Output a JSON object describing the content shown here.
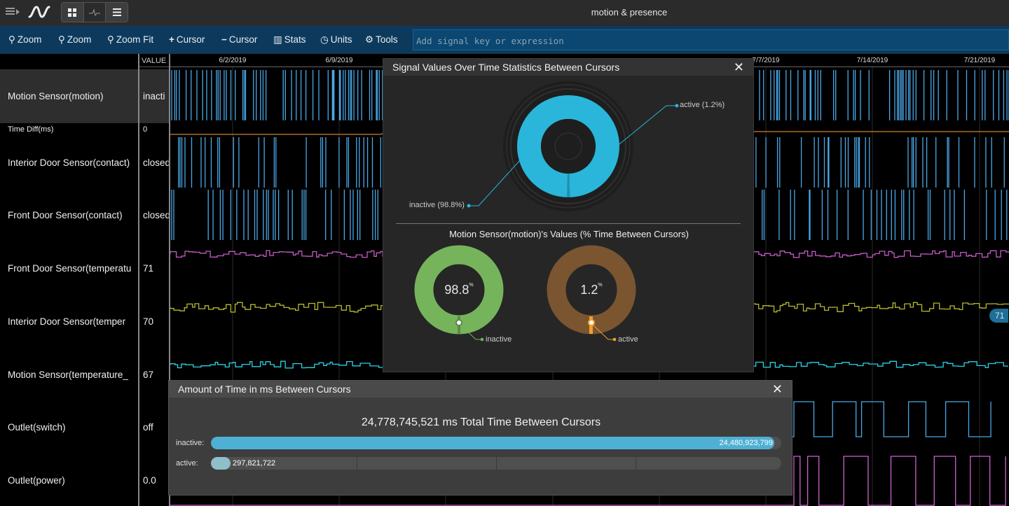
{
  "app": {
    "title": "motion & presence"
  },
  "toolbar": {
    "zoom_in": "Zoom",
    "zoom_out": "Zoom",
    "zoom_fit": "Zoom Fit",
    "add_cursor": "Cursor",
    "remove_cursor": "Cursor",
    "stats": "Stats",
    "units": "Units",
    "tools": "Tools",
    "search_placeholder": "Add signal key or expression"
  },
  "signals": {
    "value_header": "VALUE",
    "rows": [
      {
        "name": "Motion Sensor(motion)",
        "value": "inacti"
      },
      {
        "name": "Time Diff(ms)",
        "value": "0"
      },
      {
        "name": "Interior Door Sensor(contact)",
        "value": "closed"
      },
      {
        "name": "Front Door Sensor(contact)",
        "value": "closed"
      },
      {
        "name": "Front Door Sensor(temperatu",
        "value": "71"
      },
      {
        "name": "Interior Door Sensor(temper",
        "value": "70"
      },
      {
        "name": "Motion Sensor(temperature_",
        "value": "67"
      },
      {
        "name": "Outlet(switch)",
        "value": "off"
      },
      {
        "name": "Outlet(power)",
        "value": "0.0"
      }
    ]
  },
  "timeline": {
    "dates": [
      "6/2/2019",
      "6/9/2019",
      "7/7/2019",
      "7/14/2019",
      "7/21/2019"
    ],
    "hover_badge": "71"
  },
  "colors": {
    "binary": "#4aa8e8",
    "time_diff": "#d08030",
    "front_temp": "#c65ac6",
    "interior_temp": "#b8b830",
    "motion_temp": "#2ad2e8",
    "outlet_switch": "#4aa8e8",
    "outlet_power": "#d060d0",
    "inactive_ring": "#29b6da",
    "inactive_donut": "#76b45c",
    "active_donut": "#7a5530",
    "active_accent": "#f0a030"
  },
  "stats_panel": {
    "title": "Signal Values Over Time Statistics Between Cursors",
    "ring_labels": {
      "active": "active (1.2%)",
      "inactive": "inactive (98.8%)"
    },
    "subtitle": "Motion Sensor(motion)'s Values (% Time Between Cursors)",
    "donuts": [
      {
        "value": "98.8",
        "percent": 98.8,
        "unit": "%",
        "label": "inactive"
      },
      {
        "value": "1.2",
        "percent": 1.2,
        "unit": "%",
        "label": "active"
      }
    ]
  },
  "time_panel": {
    "title": "Amount of Time in ms Between Cursors",
    "total": "24,778,745,521 ms Total Time Between Cursors",
    "bars": [
      {
        "label": "inactive:",
        "value": "24,480,923,799",
        "fraction": 0.988
      },
      {
        "label": "active:",
        "value": "297,821,722",
        "fraction": 0.012
      }
    ]
  }
}
